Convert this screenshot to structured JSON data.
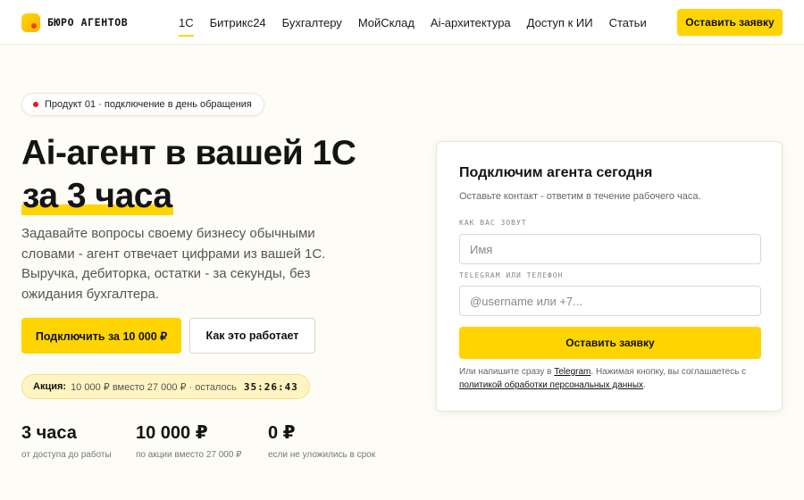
{
  "header": {
    "logo_text": "БЮРО АГЕНТОВ",
    "nav": [
      "1С",
      "Битрикс24",
      "Бухгалтеру",
      "МойСклад",
      "Ai-архитектура",
      "Доступ к ИИ",
      "Статьи"
    ],
    "active_nav": "1С",
    "cta_label": "Оставить заявку"
  },
  "hero": {
    "badge": "Продукт 01 · подключение в день обращения",
    "title_line1": "Ai-агент в вашей 1С",
    "title_line2": "за 3 часа",
    "subtitle": "Задавайте вопросы своему бизнесу обычными словами - агент отвечает цифрами из вашей 1С. Выручка, дебиторка, остатки - за секунды, без ожидания бухгалтера.",
    "primary_button": "Подключить за 10 000 ₽",
    "secondary_button": "Как это работает",
    "promo": {
      "label": "Акция:",
      "text": "10 000 ₽ вместо 27 000 ₽ · осталось",
      "timer": "35:26:43"
    },
    "stats": [
      {
        "value": "3 часа",
        "caption": "от доступа до работы"
      },
      {
        "value": "10 000 ₽",
        "caption": "по акции вместо 27 000 ₽"
      },
      {
        "value": "0 ₽",
        "caption": "если не уложились в срок"
      }
    ]
  },
  "form": {
    "title": "Подключим агента сегодня",
    "subtitle": "Оставьте контакт - ответим в течение рабочего часа.",
    "name_label": "КАК ВАС ЗОВУТ",
    "name_placeholder": "Имя",
    "contact_label": "TELEGRAM ИЛИ ТЕЛЕФОН",
    "contact_placeholder": "@username или +7...",
    "submit_label": "Оставить заявку",
    "note_prefix": "Или напишите сразу в",
    "note_link_telegram": "Telegram",
    "note_middle": ". Нажимая кнопку, вы соглашаетесь с",
    "note_link_policy": "политикой обработки персональных данных",
    "note_suffix": "."
  },
  "colors": {
    "accent": "#ffd400",
    "background": "#fdfcf6",
    "status_dot": "#e01e1e"
  }
}
